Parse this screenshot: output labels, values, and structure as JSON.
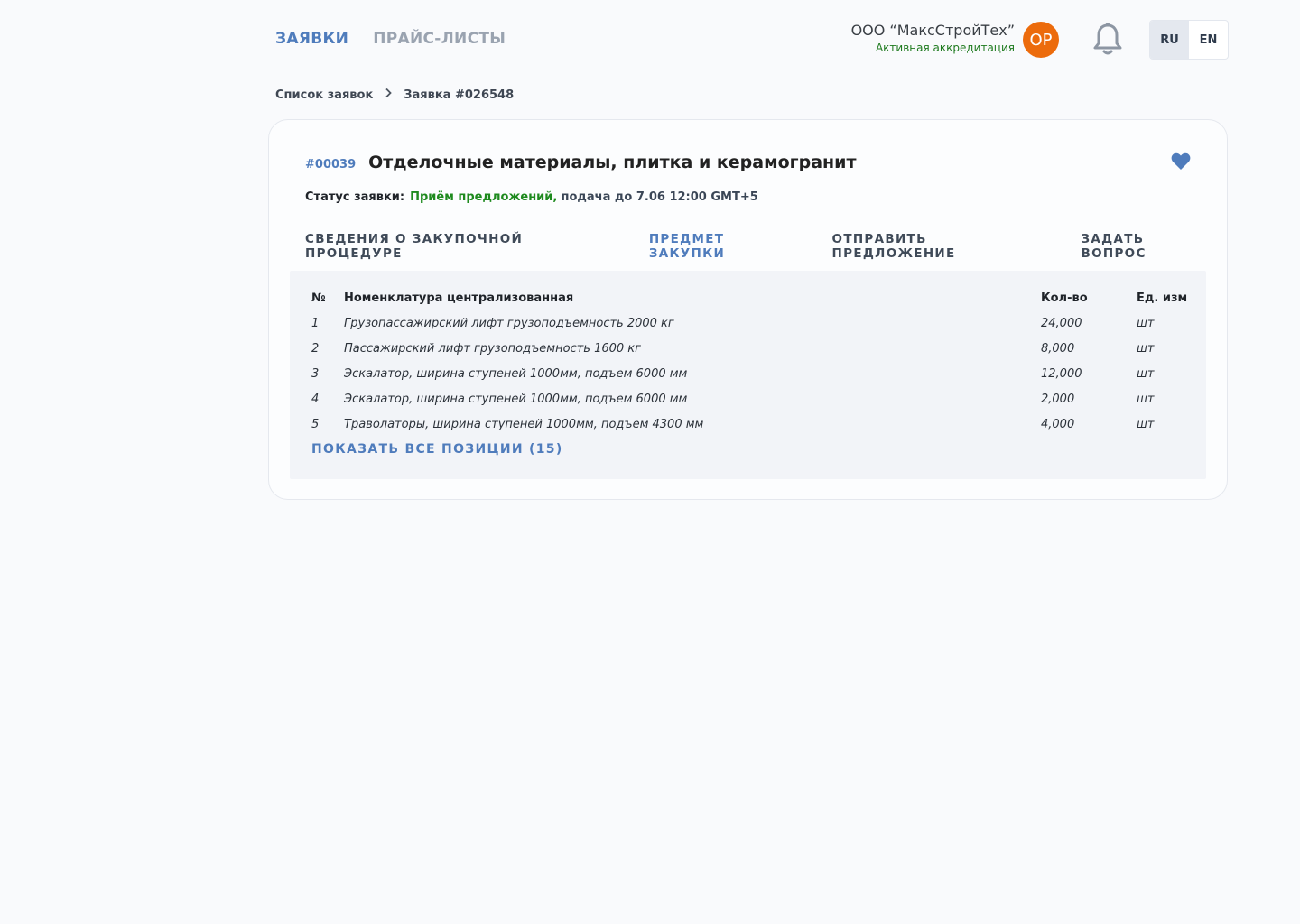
{
  "nav": {
    "items": [
      {
        "label": "ЗАЯВКИ"
      },
      {
        "label": "ПРАЙС-ЛИСТЫ"
      }
    ]
  },
  "company": {
    "name": "ООО “МаксСтройТех”",
    "status": "Активная аккредитация",
    "avatar_initials": "ОР",
    "avatar_color": "#ec6b0c"
  },
  "lang": {
    "ru": "RU",
    "en": "EN"
  },
  "breadcrumb": {
    "parent": "Список заявок",
    "current": "Заявка #026548"
  },
  "card": {
    "id": "#00039",
    "title": "Отделочные материалы, плитка и керамогранит",
    "status_label": "Статус заявки:",
    "status_value": "Приём предложений,",
    "status_deadline": "подача до 7.06 12:00 GMT+5"
  },
  "tabs": [
    {
      "label": "СВЕДЕНИЯ О ЗАКУПОЧНОЙ ПРОЦЕДУРЕ"
    },
    {
      "label": "ПРЕДМЕТ ЗАКУПКИ"
    },
    {
      "label": "ОТПРАВИТЬ ПРЕДЛОЖЕНИЕ"
    },
    {
      "label": "ЗАДАТЬ ВОПРОС"
    }
  ],
  "table": {
    "headers": {
      "num": "№",
      "name": "Номенклатура централизованная",
      "qty": "Кол-во",
      "unit": "Ед. изм"
    },
    "rows": [
      {
        "num": "1",
        "name": "Грузопассажирский лифт грузоподъемность 2000 кг",
        "qty": "24,000",
        "unit": "шт"
      },
      {
        "num": "2",
        "name": "Пассажирский лифт грузоподъемность 1600 кг",
        "qty": "8,000",
        "unit": "шт"
      },
      {
        "num": "3",
        "name": "Эскалатор, ширина ступеней 1000мм, подъем 6000 мм",
        "qty": "12,000",
        "unit": "шт"
      },
      {
        "num": "4",
        "name": "Эскалатор, ширина ступеней 1000мм, подъем 6000 мм",
        "qty": "2,000",
        "unit": "шт"
      },
      {
        "num": "5",
        "name": "Траволаторы, ширина ступеней 1000мм, подъем 4300 мм",
        "qty": "4,000",
        "unit": "шт"
      }
    ],
    "show_all": "ПОКАЗАТЬ ВСЕ ПОЗИЦИИ (15)"
  },
  "colors": {
    "accent": "#4f7cbc",
    "status_green": "#1e8a1e"
  }
}
